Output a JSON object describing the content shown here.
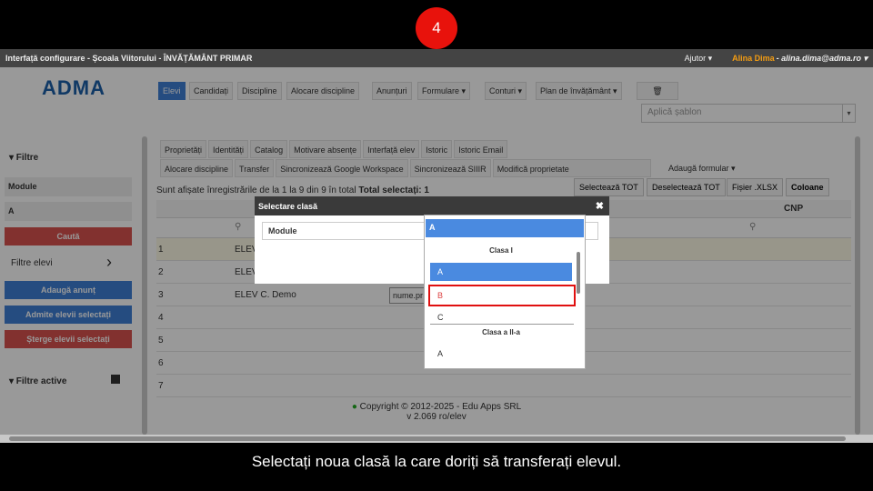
{
  "step_number": "4",
  "caption": "Selectați noua clasă la care doriți să transferați elevul.",
  "topbar": {
    "title": "Interfață configurare - Școala Viitorului - ÎNVĂȚĂMÂNT PRIMAR",
    "help": "Ajutor ▾",
    "user_name": "Alina Dima",
    "user_email": "- alina.dima@adma.ro ▾"
  },
  "logo": "ADMA",
  "nav": {
    "elevi": "Elevi",
    "candidati": "Candidați",
    "discipline": "Discipline",
    "alocare": "Alocare discipline",
    "anunturi": "Anunțuri",
    "formulare": "Formulare ▾",
    "conturi": "Conturi ▾",
    "plan": "Plan de învățământ ▾",
    "trash_icon": "🗑"
  },
  "template_select": {
    "placeholder": "Aplică șablon",
    "arrow": "▾"
  },
  "sidebar": {
    "filters_title": "▾  Filtre",
    "module": "Module",
    "a_field": "A",
    "search": "Caută",
    "filtre_elevi": "Filtre elevi",
    "chevron": "›",
    "add_notice": "Adaugă anunț",
    "admit": "Admite elevii selectați",
    "delete": "Șterge elevii selectați",
    "active_filters": "▾  Filtre active"
  },
  "tabs_row1": [
    "Proprietăți",
    "Identități",
    "Catalog",
    "Motivare absențe",
    "Interfață elev",
    "Istoric",
    "Istoric Email"
  ],
  "tabs_row2": [
    "Alocare discipline",
    "Transfer",
    "Sincronizează Google Workspace",
    "Sincronizează SIIIR",
    "Modifică proprietate"
  ],
  "add_form": "Adaugă formular ▾",
  "info_text": "Sunt afișate înregistrările de la 1 la 9 din 9 în total",
  "total_selected": "Total selectați: 1",
  "buttons": {
    "select_all": "Selectează TOT",
    "deselect_all": "Deselectează TOT",
    "xlsx": "Fișier .XLSX",
    "columns": "Coloane"
  },
  "grid": {
    "cnp_header": "CNP",
    "rows": [
      {
        "n": "1",
        "name": "ELEV"
      },
      {
        "n": "2",
        "name": "ELEV"
      },
      {
        "n": "3",
        "name": "ELEV C. Demo",
        "field": "nume.pr"
      },
      {
        "n": "4",
        "name": ""
      },
      {
        "n": "5",
        "name": ""
      },
      {
        "n": "6",
        "name": ""
      },
      {
        "n": "7",
        "name": ""
      }
    ]
  },
  "modal": {
    "title": "Selectare clasă",
    "close": "✖",
    "select_value": "Module"
  },
  "dropdown": {
    "selected": "A",
    "group1": "Clasa I",
    "opt_a": "A",
    "opt_b": "B",
    "opt_c": "C",
    "group2": "Clasa a II-a",
    "opt_a2": "A"
  },
  "footer": {
    "copyright": "Copyright © 2012-2025 - Edu Apps SRL",
    "version": "v 2.069 ro/elev"
  },
  "colors": {
    "accent": "#3f7fd6",
    "danger": "#d9534f",
    "highlight": "#e01010"
  }
}
